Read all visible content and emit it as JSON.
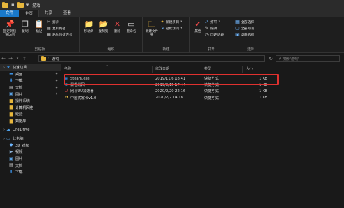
{
  "window": {
    "title": "游戏"
  },
  "ribbon_tabs": [
    "文件",
    "主页",
    "共享",
    "查看"
  ],
  "ribbon": {
    "clipboard": {
      "label": "剪贴板",
      "pin": "固定到快速访问",
      "copy": "复制",
      "paste": "粘贴",
      "cut": "剪切",
      "copy_path": "复制路径",
      "paste_shortcut": "粘贴快捷方式"
    },
    "organize": {
      "label": "组织",
      "move_to": "移动到",
      "copy_to": "复制到",
      "delete": "删除",
      "rename": "重命名"
    },
    "new": {
      "label": "新建",
      "new_folder": "新建文件夹",
      "new_item": "新建项目",
      "easy_access": "轻松访问"
    },
    "open": {
      "label": "打开",
      "properties": "属性",
      "open": "打开",
      "edit": "编辑",
      "history": "历史记录"
    },
    "select": {
      "label": "选择",
      "select_all": "全部选择",
      "select_none": "全部取消",
      "invert": "反向选择"
    }
  },
  "address": {
    "path": "游戏",
    "search_placeholder": "搜索\"游戏\""
  },
  "nav": [
    {
      "label": "快速访问",
      "icon": "star-icon",
      "color": "#3b8fe0",
      "pinned": false,
      "level": 0
    },
    {
      "label": "桌面",
      "icon": "desktop-icon",
      "color": "#3b8fe0",
      "pinned": true,
      "level": 1
    },
    {
      "label": "下载",
      "icon": "download-icon",
      "color": "#3b8fe0",
      "pinned": true,
      "level": 1
    },
    {
      "label": "文档",
      "icon": "document-icon",
      "color": "#d0d0d0",
      "pinned": true,
      "level": 1
    },
    {
      "label": "图片",
      "icon": "picture-icon",
      "color": "#5aa0e0",
      "pinned": true,
      "level": 1
    },
    {
      "label": "操作系统",
      "icon": "folder-icon",
      "color": "#e7b73d",
      "pinned": false,
      "level": 1
    },
    {
      "label": "计算机网络",
      "icon": "folder-icon",
      "color": "#e7b73d",
      "pinned": false,
      "level": 1
    },
    {
      "label": "经验",
      "icon": "folder-icon",
      "color": "#e7b73d",
      "pinned": false,
      "level": 1
    },
    {
      "label": "数据库",
      "icon": "folder-icon",
      "color": "#e7b73d",
      "pinned": false,
      "level": 1
    },
    {
      "label": "",
      "icon": "",
      "color": "",
      "pinned": false,
      "level": -1
    },
    {
      "label": "OneDrive",
      "icon": "cloud-icon",
      "color": "#4ea1ea",
      "pinned": false,
      "level": 0
    },
    {
      "label": "",
      "icon": "",
      "color": "",
      "pinned": false,
      "level": -1
    },
    {
      "label": "此电脑",
      "icon": "computer-icon",
      "color": "#5aa0e0",
      "pinned": false,
      "level": 0
    },
    {
      "label": "3D 对象",
      "icon": "3d-objects-icon",
      "color": "#6fb7ff",
      "pinned": false,
      "level": 1
    },
    {
      "label": "视频",
      "icon": "video-icon",
      "color": "#8fb4d9",
      "pinned": false,
      "level": 1
    },
    {
      "label": "图片",
      "icon": "picture-icon",
      "color": "#5aa0e0",
      "pinned": false,
      "level": 1
    },
    {
      "label": "文档",
      "icon": "document-icon",
      "color": "#d0d0d0",
      "pinned": false,
      "level": 1
    },
    {
      "label": "下载",
      "icon": "download-icon",
      "color": "#3b8fe0",
      "pinned": false,
      "level": 1
    }
  ],
  "columns": {
    "name": "名称",
    "date": "修改日期",
    "type": "类型",
    "size": "大小"
  },
  "files": [
    {
      "name": "Steam.exe",
      "date": "2019/11/6 18:41",
      "type": "快捷方式",
      "size": "1 KB",
      "icon": "steam-icon",
      "color": "#2a76c6"
    },
    {
      "name": "暴雪战网",
      "date": "2019/9/15 17:44",
      "type": "快捷方式",
      "size": "1 KB",
      "icon": "battlenet-icon",
      "color": "#1fa3e8"
    },
    {
      "name": "网易UU加速器",
      "date": "2020/2/20 22:16",
      "type": "快捷方式",
      "size": "1 KB",
      "icon": "uu-booster-icon",
      "color": "#e24a4a"
    },
    {
      "name": "中国式家长v1.0",
      "date": "2020/2/2 14:18",
      "type": "快捷方式",
      "size": "1 KB",
      "icon": "game-icon",
      "color": "#e8c24a"
    }
  ]
}
